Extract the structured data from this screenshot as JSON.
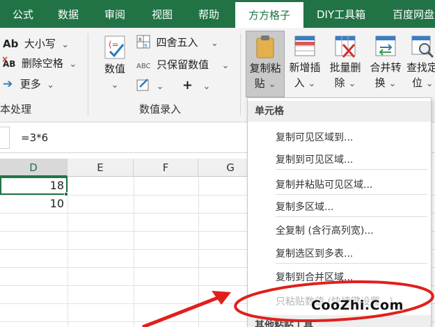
{
  "tabs": [
    "公式",
    "数据",
    "审阅",
    "视图",
    "帮助",
    "方方格子",
    "DIY工具箱",
    "百度网盘"
  ],
  "active_tab": "方方格子",
  "ribbon": {
    "case_label": "大小写",
    "remove_space_label": "删除空格",
    "more_label": "更多",
    "text_group_label": "本处理",
    "value_label": "数值",
    "round_label": "四舍五入",
    "keep_value_label": "只保留数值",
    "entry_group_label": "数值录入",
    "copy_paste": [
      "复制粘",
      "贴"
    ],
    "new_insert": [
      "新增插",
      "入"
    ],
    "batch_delete": [
      "批量删",
      "除"
    ],
    "merge_convert": [
      "合并转",
      "换"
    ],
    "find_locate": [
      "查找定",
      "位"
    ]
  },
  "formula_bar": {
    "content": "=3*6"
  },
  "grid": {
    "columns": [
      "D",
      "E",
      "F",
      "G"
    ],
    "selected_column": "D",
    "cells": {
      "D1": "18",
      "D2": "10"
    }
  },
  "menu": {
    "header_cells": "单元格",
    "items": [
      "复制可见区域到...",
      "复制到可见区域...",
      "复制并粘贴可见区域...",
      "复制多区域...",
      "全复制 (含行高列宽)...",
      "复制选区到多表...",
      "复制到合并区域...",
      "只粘贴数值 (快捷键设置...)"
    ],
    "header_other": "其他粘贴工具"
  },
  "watermark": "CooZhi.Com",
  "colors": {
    "ribbon_green": "#217346",
    "annotation_red": "#e0201b"
  }
}
